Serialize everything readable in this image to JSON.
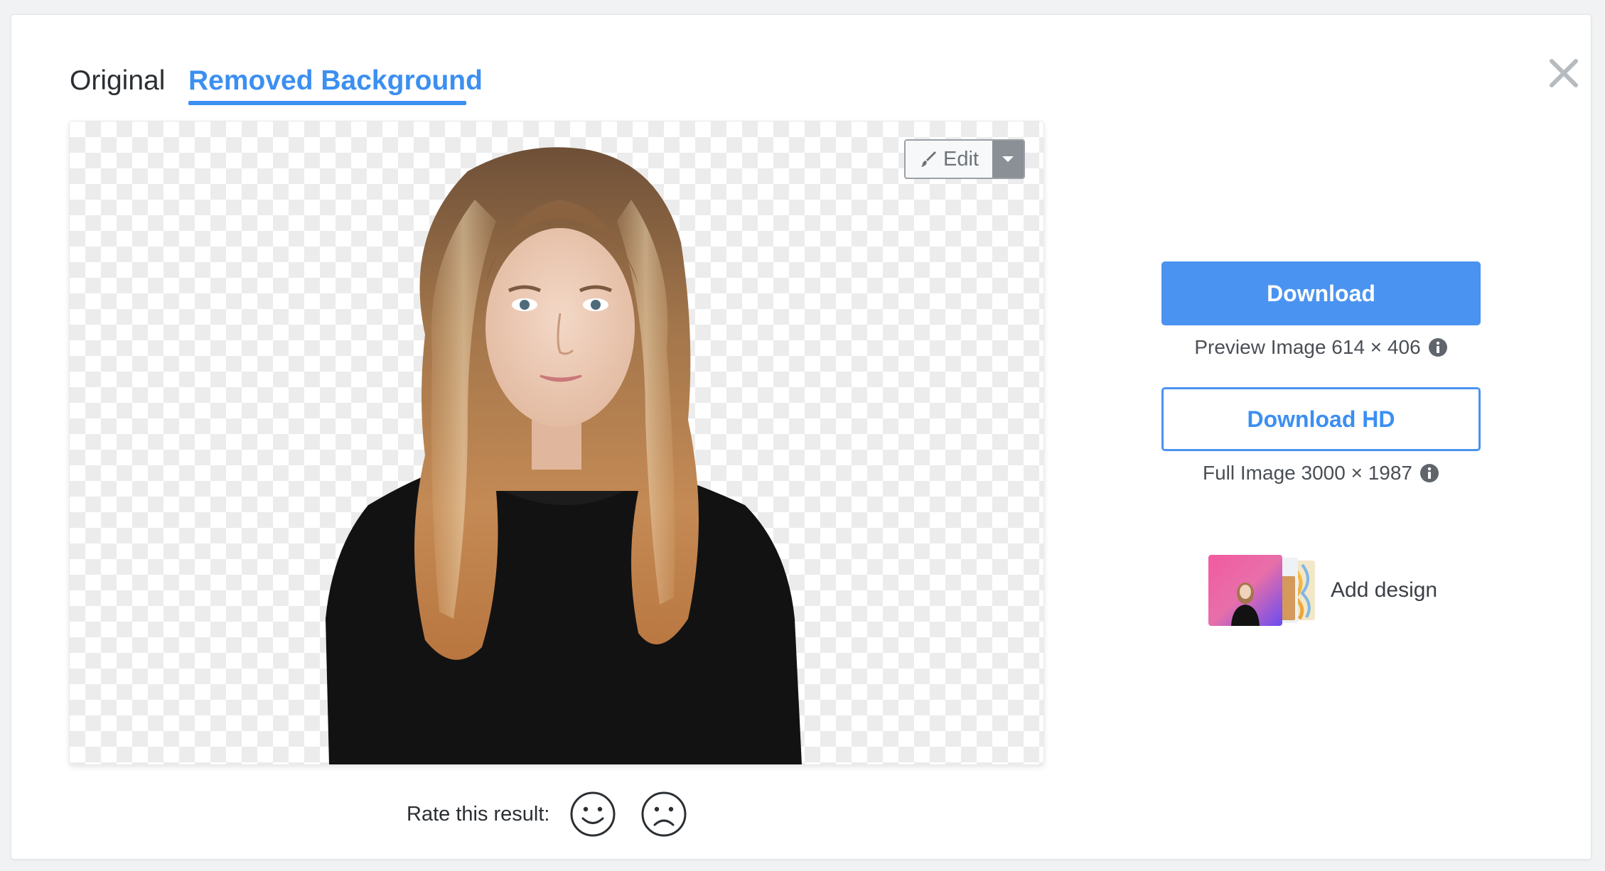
{
  "tabs": {
    "original_label": "Original",
    "removed_label": "Removed Background",
    "active": "Removed Background"
  },
  "preview": {
    "edit_label": "Edit"
  },
  "rating": {
    "label": "Rate this result:"
  },
  "download": {
    "label": "Download",
    "size_note": "Preview Image 614 × 406"
  },
  "download_hd": {
    "label": "Download HD",
    "size_note": "Full Image 3000 × 1987"
  },
  "add_design": {
    "label": "Add design"
  },
  "colors": {
    "accent": "#3c8ff1",
    "button_fill": "#4b93f0",
    "text": "#2b2f33",
    "muted": "#6d7379"
  },
  "icons": {
    "close": "close-icon",
    "brush": "brush-icon",
    "dropdown": "chevron-down-icon",
    "happy": "smiley-icon",
    "sad": "frown-icon",
    "info": "info-icon"
  }
}
